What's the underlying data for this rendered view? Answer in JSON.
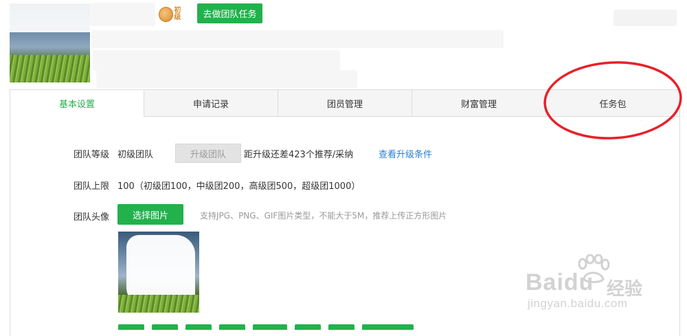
{
  "header": {
    "level_badge_text": "初级",
    "team_task_button": "去做团队任务"
  },
  "tabs": [
    {
      "label": "基本设置",
      "active": true
    },
    {
      "label": "申请记录",
      "active": false
    },
    {
      "label": "团员管理",
      "active": false
    },
    {
      "label": "财富管理",
      "active": false
    },
    {
      "label": "任务包",
      "active": false
    }
  ],
  "settings": {
    "level": {
      "label": "团队等级",
      "value": "初级团队",
      "upgrade_button": "升级团队",
      "gap_text": "距升级还差423个推荐/采纳",
      "link": "查看升级条件"
    },
    "limit": {
      "label": "团队上限",
      "value": "100（初级团100，中级团200，高级团500，超级团1000）"
    },
    "avatar": {
      "label": "团队头像",
      "choose_button": "选择图片",
      "hint": "支持JPG、PNG、GIF图片类型，不能大于5M，推荐上传正方形图片"
    }
  },
  "annotation": {
    "color": "#e8202a",
    "target": "任务包"
  },
  "colors": {
    "accent": "#22b14c",
    "link": "#2a7fd4",
    "tab_bg": "#f5f5f5",
    "border": "#dcdcdc"
  },
  "watermark": {
    "brand": "Baidu",
    "suffix": "经验",
    "url": "jingyan.baidu.com"
  }
}
